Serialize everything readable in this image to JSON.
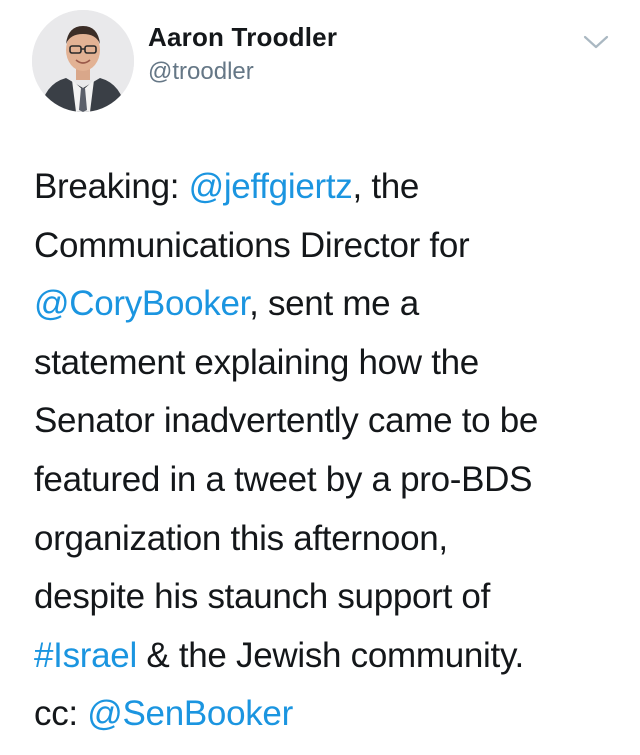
{
  "author": {
    "name": "Aaron Troodler",
    "handle": "@troodler"
  },
  "icons": {
    "menu": "chevron-down-icon"
  },
  "colors": {
    "link": "#1b95e0",
    "text": "#14171a",
    "secondary": "#657786"
  },
  "tweet": {
    "lines": [
      {
        "parts": [
          {
            "text": "Breaking: "
          },
          {
            "text": "@jeffgiertz",
            "link": true
          },
          {
            "text": ", the"
          }
        ]
      },
      {
        "parts": [
          {
            "text": "Communications Director for"
          }
        ]
      },
      {
        "parts": [
          {
            "text": "@CoryBooker",
            "link": true
          },
          {
            "text": ", sent me a"
          }
        ]
      },
      {
        "parts": [
          {
            "text": "statement explaining how the"
          }
        ]
      },
      {
        "parts": [
          {
            "text": "Senator inadvertently came to be"
          }
        ]
      },
      {
        "parts": [
          {
            "text": "featured in a tweet by a pro-BDS"
          }
        ]
      },
      {
        "parts": [
          {
            "text": "organization this afternoon,"
          }
        ]
      },
      {
        "parts": [
          {
            "text": "despite his staunch support of"
          }
        ]
      },
      {
        "parts": [
          {
            "text": "#Israel",
            "link": true
          },
          {
            "text": " & the Jewish community."
          }
        ]
      },
      {
        "parts": [
          {
            "text": "cc: "
          },
          {
            "text": "@SenBooker",
            "link": true
          }
        ]
      }
    ]
  }
}
